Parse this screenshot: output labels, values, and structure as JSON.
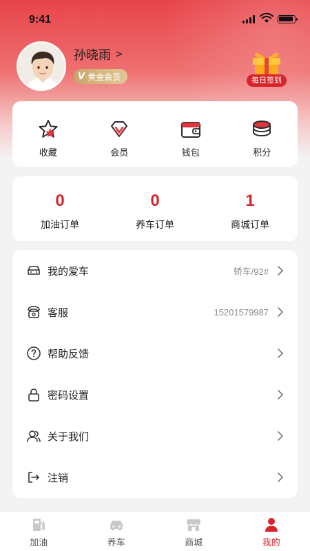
{
  "status_bar": {
    "time": "9:41"
  },
  "profile": {
    "name": "孙晓雨",
    "chevron": ">",
    "vip_mark": "V",
    "vip_level": "黄金会员",
    "checkin_label": "每日签到"
  },
  "quick_actions": [
    {
      "label": "收藏",
      "icon": "star-icon"
    },
    {
      "label": "会员",
      "icon": "diamond-icon"
    },
    {
      "label": "钱包",
      "icon": "wallet-icon"
    },
    {
      "label": "积分",
      "icon": "coins-icon"
    }
  ],
  "orders": [
    {
      "count": "0",
      "label": "加油订单"
    },
    {
      "count": "0",
      "label": "养车订单"
    },
    {
      "count": "1",
      "label": "商城订单"
    }
  ],
  "menu": [
    {
      "label": "我的爱车",
      "value": "轿车/92#",
      "icon": "car-icon"
    },
    {
      "label": "客服",
      "value": "15201579987",
      "icon": "phone-icon"
    },
    {
      "label": "帮助反馈",
      "value": "",
      "icon": "help-icon"
    },
    {
      "label": "密码设置",
      "value": "",
      "icon": "lock-icon"
    },
    {
      "label": "关于我们",
      "value": "",
      "icon": "users-icon"
    },
    {
      "label": "注销",
      "value": "",
      "icon": "logout-icon"
    }
  ],
  "tabbar": [
    {
      "label": "加油",
      "icon": "fuel-icon",
      "active": false
    },
    {
      "label": "养车",
      "icon": "car-icon",
      "active": false
    },
    {
      "label": "商城",
      "icon": "shop-icon",
      "active": false
    },
    {
      "label": "我的",
      "icon": "user-icon",
      "active": true
    }
  ],
  "colors": {
    "accent": "#d8232b",
    "gold": "#caa56b",
    "background": "#f3f3f3"
  }
}
